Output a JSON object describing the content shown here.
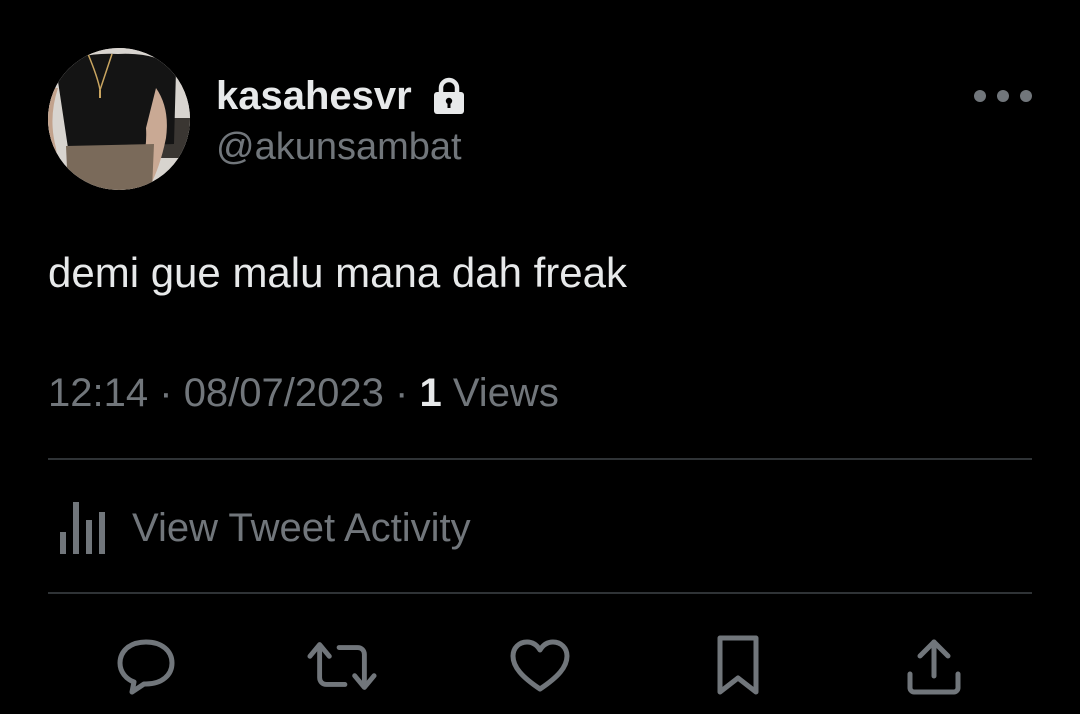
{
  "tweet": {
    "display_name": "kasahesvr",
    "handle": "@akunsambat",
    "text": "demi gue malu mana dah freak",
    "time": "12:14",
    "separator": "·",
    "date": "08/07/2023",
    "views_count": "1",
    "views_label": "Views",
    "activity_label": "View Tweet Activity"
  },
  "icons": {
    "lock": "lock-icon",
    "more": "more-horizontal-icon",
    "activity": "bar-chart-icon",
    "reply": "speech-bubble-icon",
    "retweet": "retweet-arrows-icon",
    "like": "heart-icon",
    "bookmark": "bookmark-icon",
    "share": "share-upload-icon"
  },
  "colors": {
    "background": "#000000",
    "primary_text": "#e7e9ea",
    "secondary_text": "#71767b",
    "divider": "#2f3336"
  }
}
